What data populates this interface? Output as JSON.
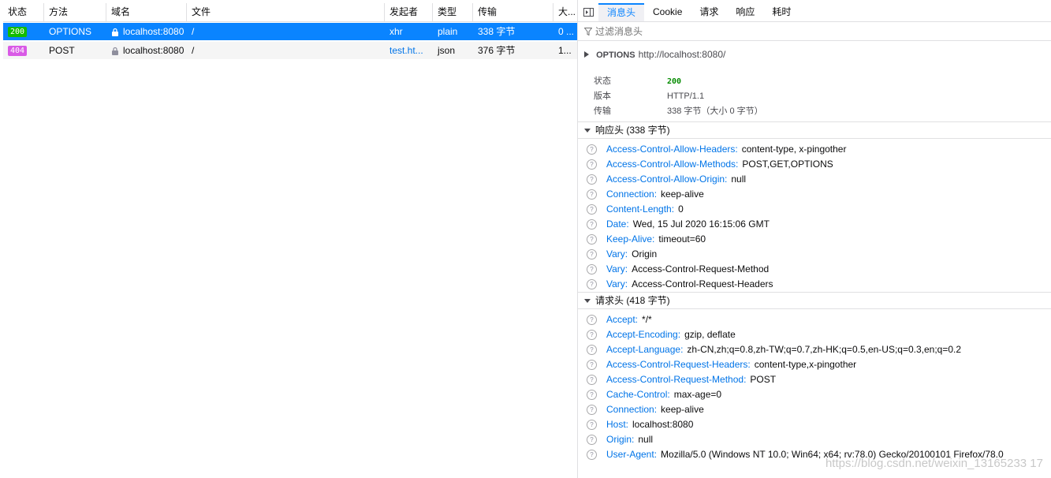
{
  "columns": {
    "status": "状态",
    "method": "方法",
    "domain": "域名",
    "file": "文件",
    "initiator": "发起者",
    "type": "类型",
    "transferred": "传输",
    "size": "大..."
  },
  "requests": [
    {
      "status": "200",
      "method": "OPTIONS",
      "domain": "localhost:8080",
      "file": "/",
      "initiator": "xhr",
      "type": "plain",
      "transferred": "338 字节",
      "size": "0 ..."
    },
    {
      "status": "404",
      "method": "POST",
      "domain": "localhost:8080",
      "file": "/",
      "initiator": "test.ht...",
      "type": "json",
      "transferred": "376 字节",
      "size": "1..."
    }
  ],
  "tabs": [
    "消息头",
    "Cookie",
    "请求",
    "响应",
    "耗时"
  ],
  "filter_placeholder": "过滤消息头",
  "summary": {
    "method": "OPTIONS",
    "url": "http://localhost:8080/"
  },
  "info": {
    "status_label": "状态",
    "status_value": "200",
    "version_label": "版本",
    "version_value": "HTTP/1.1",
    "transfer_label": "传输",
    "transfer_value": "338 字节（大小 0 字节）"
  },
  "response_headers_title": "响应头 (338 字节)",
  "response_headers": [
    {
      "name": "Access-Control-Allow-Headers:",
      "value": "content-type, x-pingother"
    },
    {
      "name": "Access-Control-Allow-Methods:",
      "value": "POST,GET,OPTIONS"
    },
    {
      "name": "Access-Control-Allow-Origin:",
      "value": "null"
    },
    {
      "name": "Connection:",
      "value": "keep-alive"
    },
    {
      "name": "Content-Length:",
      "value": "0"
    },
    {
      "name": "Date:",
      "value": "Wed, 15 Jul 2020 16:15:06 GMT"
    },
    {
      "name": "Keep-Alive:",
      "value": "timeout=60"
    },
    {
      "name": "Vary:",
      "value": "Origin"
    },
    {
      "name": "Vary:",
      "value": "Access-Control-Request-Method"
    },
    {
      "name": "Vary:",
      "value": "Access-Control-Request-Headers"
    }
  ],
  "request_headers_title": "请求头 (418 字节)",
  "request_headers": [
    {
      "name": "Accept:",
      "value": "*/*"
    },
    {
      "name": "Accept-Encoding:",
      "value": "gzip, deflate"
    },
    {
      "name": "Accept-Language:",
      "value": "zh-CN,zh;q=0.8,zh-TW;q=0.7,zh-HK;q=0.5,en-US;q=0.3,en;q=0.2"
    },
    {
      "name": "Access-Control-Request-Headers:",
      "value": "content-type,x-pingother"
    },
    {
      "name": "Access-Control-Request-Method:",
      "value": "POST"
    },
    {
      "name": "Cache-Control:",
      "value": "max-age=0"
    },
    {
      "name": "Connection:",
      "value": "keep-alive"
    },
    {
      "name": "Host:",
      "value": "localhost:8080"
    },
    {
      "name": "Origin:",
      "value": "null"
    },
    {
      "name": "User-Agent:",
      "value": "Mozilla/5.0 (Windows NT 10.0; Win64; x64; rv:78.0) Gecko/20100101 Firefox/78.0"
    }
  ],
  "help_glyph": "?",
  "watermark": "https://blog.csdn.net/weixin_13165233 17"
}
